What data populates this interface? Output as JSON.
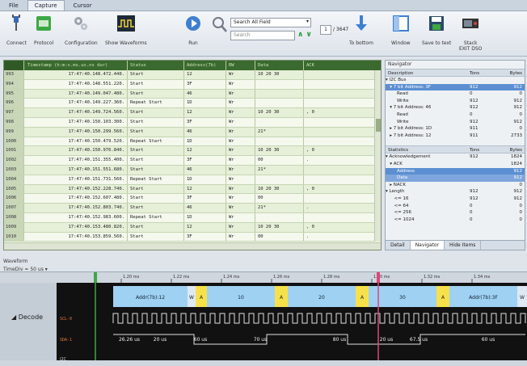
{
  "menu": {
    "tabs": [
      "File",
      "Capture",
      "Cursor"
    ],
    "active": "Capture"
  },
  "toolbar": {
    "connect": "Connect",
    "protocol": "Protocol",
    "configuration": "Configuration",
    "show_waveforms": "Show Waveforms",
    "run": "Run",
    "search_field": "Search All Field",
    "search_placeholder": "Search",
    "page_current": "1",
    "page_total": "/ 3647",
    "to_bottom": "To bottom",
    "window": "Window",
    "save_to_text": "Save to text",
    "stack_exit": "Stack\nEXIT DSO"
  },
  "table": {
    "headers": [
      "",
      "Timestamp (h:m:s.ms.us.ns dur)",
      "Status",
      "Address(7b)",
      "RW",
      "Data",
      "ACK"
    ],
    "rows": [
      [
        "993",
        "17:47:40.148.472.440.",
        "Start",
        "12",
        "Wr",
        "10 20 30",
        ""
      ],
      [
        "994",
        "17:47:40.148.551.220.",
        "Start",
        "3F",
        "Wr",
        "",
        ""
      ],
      [
        "995",
        "17:47:40.149.047.480.",
        "Start",
        "46",
        "Wr",
        "",
        ""
      ],
      [
        "996",
        "17:47:40.149.227.360.",
        "Repeat Start",
        "1D",
        "Wr",
        "",
        ""
      ],
      [
        "997",
        "17:47:40.149.724.560.",
        "Start",
        "12",
        "Wr",
        "10 20 30",
        ", 0"
      ],
      [
        "998",
        "17:47:40.150.103.300.",
        "Start",
        "3F",
        "Wr",
        "",
        ""
      ],
      [
        "999",
        "17:47:40.150.299.560.",
        "Start",
        "46",
        "Wr",
        "21*",
        ""
      ],
      [
        "1000",
        "17:47:40.150.479.520.",
        "Repeat Start",
        "1D",
        "Wr",
        "",
        ""
      ],
      [
        "1001",
        "17:47:40.150.976.840.",
        "Start",
        "12",
        "Wr",
        "10 20 30",
        ", 0"
      ],
      [
        "1002",
        "17:47:40.151.355.400.",
        "Start",
        "3F",
        "Wr",
        "00",
        "."
      ],
      [
        "1003",
        "17:47:40.151.551.680.",
        "Start",
        "46",
        "Wr",
        "21*",
        ""
      ],
      [
        "1004",
        "17:47:40.151.731.560.",
        "Repeat Start",
        "1D",
        "Wr",
        "",
        ""
      ],
      [
        "1005",
        "17:47:40.152.228.740.",
        "Start",
        "12",
        "Wr",
        "10 20 30",
        ", 0"
      ],
      [
        "1006",
        "17:47:40.152.607.480.",
        "Start",
        "3F",
        "Wr",
        "00",
        ""
      ],
      [
        "1007",
        "17:47:40.152.803.740.",
        "Start",
        "46",
        "Wr",
        "21*",
        "."
      ],
      [
        "1008",
        "17:47:40.152.983.600.",
        "Repeat Start",
        "1D",
        "Wr",
        "",
        ""
      ],
      [
        "1009",
        "17:47:40.153.480.820.",
        "Start",
        "12",
        "Wr",
        "10 20 30",
        ", 0"
      ],
      [
        "1010",
        "17:47:40.153.859.560.",
        "Start",
        "3F",
        "Wr",
        "00",
        "."
      ]
    ]
  },
  "navigator": {
    "title": "Navigator",
    "headers": [
      "Description",
      "Tons",
      "Bytes"
    ],
    "rows": [
      {
        "name": "▾ I2C Bus",
        "a": "",
        "b": "",
        "style": ""
      },
      {
        "name": "   ▾ 7 bit Address: 3F",
        "a": "912",
        "b": "912",
        "style": "sel"
      },
      {
        "name": "        Read",
        "a": "0",
        "b": "0",
        "style": ""
      },
      {
        "name": "        Write",
        "a": "912",
        "b": "912",
        "style": ""
      },
      {
        "name": "   ▾ 7 bit Address: 46",
        "a": "912",
        "b": "912",
        "style": ""
      },
      {
        "name": "        Read",
        "a": "0",
        "b": "0",
        "style": ""
      },
      {
        "name": "        Write",
        "a": "912",
        "b": "912",
        "style": ""
      },
      {
        "name": "   ▸ 7 bit Address: 1D",
        "a": "911",
        "b": "0",
        "style": ""
      },
      {
        "name": "   ▸ 7 bit Address: 12",
        "a": "911",
        "b": "2733",
        "style": ""
      }
    ]
  },
  "statistics": {
    "headers": [
      "Statistics",
      "Tons",
      "Bytes"
    ],
    "rows": [
      {
        "name": "▾ Acknowledgement",
        "a": "912",
        "b": "1824",
        "style": ""
      },
      {
        "name": "   ▾ ACK",
        "a": "",
        "b": "1824",
        "style": ""
      },
      {
        "name": "        Address",
        "a": "",
        "b": "912",
        "style": "sel"
      },
      {
        "name": "        Data",
        "a": "",
        "b": "912",
        "style": "sub"
      },
      {
        "name": "   ▸ NACK",
        "a": "",
        "b": "0",
        "style": ""
      },
      {
        "name": "▾ Length",
        "a": "912",
        "b": "912",
        "style": ""
      },
      {
        "name": "      <= 16",
        "a": "912",
        "b": "912",
        "style": ""
      },
      {
        "name": "      <= 64",
        "a": "0",
        "b": "0",
        "style": ""
      },
      {
        "name": "      <= 256",
        "a": "0",
        "b": "0",
        "style": ""
      },
      {
        "name": "      <= 1024",
        "a": "0",
        "b": "0",
        "style": ""
      }
    ]
  },
  "panel_tabs": [
    "Detail",
    "Navigator",
    "Hide Items"
  ],
  "panel_tab_active": "Navigator",
  "waveform": {
    "title": "Waveform",
    "timediv": "TimeDiv = 50 us",
    "decode_label": "Decode",
    "channels": [
      "SCL-0",
      "SDA-1"
    ],
    "i2c_label": "I2C",
    "ruler_ticks": [
      "1.20 ms",
      "1.22 ms",
      "1.24 ms",
      "1.26 ms",
      "1.28 ms",
      "1.30 ms",
      "1.32 ms",
      "1.34 ms"
    ],
    "segments": [
      "Addr(7b):12",
      "W",
      "A",
      "10",
      "A",
      "20",
      "A",
      "30",
      "A",
      "Addr(7b):3F",
      "W"
    ],
    "durations": [
      "26.26 us",
      "20 us",
      "60 us",
      "70 us",
      "80 us",
      "20 us",
      "67.5 us",
      "60 us"
    ]
  },
  "colors": {
    "table_header": "#3a6a30",
    "row_a": "#e6efd8",
    "row_b": "#f4f8ed",
    "selection": "#5b8fd1",
    "wave_bg": "#111111",
    "decode_blue": "#9fd1f3",
    "ack_yellow": "#f7e14a"
  }
}
